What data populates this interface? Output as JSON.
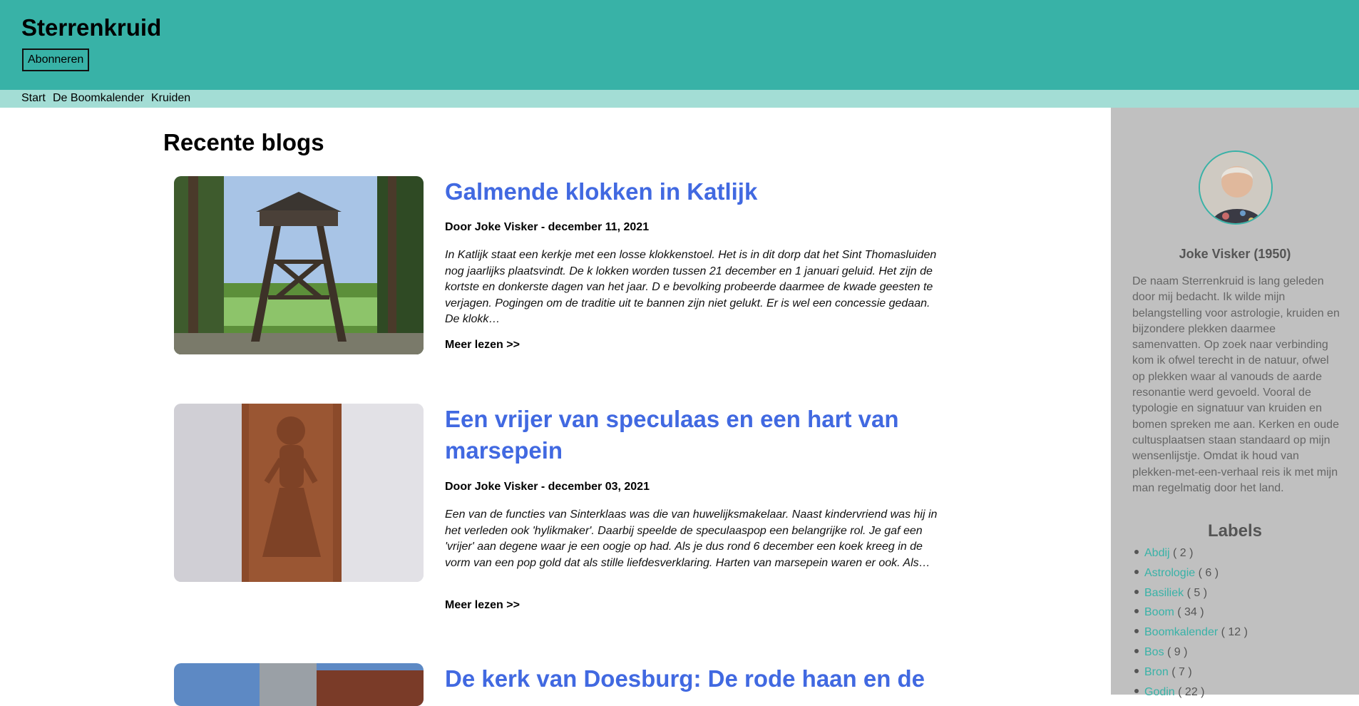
{
  "header": {
    "site_title": "Sterrenkruid",
    "subscribe_label": "Abonneren"
  },
  "nav": {
    "items": [
      {
        "label": "Start"
      },
      {
        "label": "De Boomkalender"
      },
      {
        "label": "Kruiden"
      }
    ]
  },
  "main": {
    "section_title": "Recente blogs",
    "posts": [
      {
        "title": "Galmende klokken in Katlijk",
        "meta": "Door Joke Visker - december 11, 2021",
        "excerpt": "In Katlijk staat een kerkje met een losse klokkenstoel.  Het is in dit dorp dat het Sint Thomasluiden nog jaarlijks plaatsvindt. De k lokken worden tussen 21 december en 1 januari geluid. Het zijn de kortste en donkerste dagen van het jaar. D e bevolking probeerde daarmee de kwade geesten te verjagen. Pogingen om de traditie uit te bannen zijn niet gelukt. Er is wel een concessie gedaan. De klokk…",
        "read_more": "Meer lezen >>"
      },
      {
        "title": "Een vrijer van speculaas en een hart van marsepein",
        "meta": "Door Joke Visker - december 03, 2021",
        "excerpt": "Een van de functies van Sinterklaas was die van huwelijksmakelaar. Naast kindervriend was hij in het verleden ook  'hylikmaker'. Daarbij speelde de speculaaspop een belangrijke rol.  Je gaf een 'vrijer' aan degene waar je een oogje op had.  Als je dus rond 6 december een koek kreeg in de vorm van een pop gold dat als stille liefdesverklaring. Harten van marsepein waren er ook. Als…",
        "read_more": "Meer lezen >>"
      },
      {
        "title": "De kerk van Doesburg: De rode haan en de"
      }
    ]
  },
  "sidebar": {
    "author_name": "Joke Visker (1950)",
    "author_bio": "De naam Sterrenkruid is lang geleden door mij bedacht. Ik wilde mijn belangstelling voor astrologie, kruiden en bijzondere plekken daarmee samenvatten. Op zoek naar verbinding kom ik ofwel terecht in de natuur, ofwel op plekken waar al vanouds de aarde resonantie werd gevoeld. Vooral de typologie en signatuur van kruiden en bomen spreken me aan. Kerken en oude cultusplaatsen staan standaard op mijn wensenlijstje. Omdat ik houd van plekken-met-een-verhaal reis ik met mijn man regelmatig door het land.",
    "labels_title": "Labels",
    "labels": [
      {
        "name": "Abdij",
        "count": "( 2 )"
      },
      {
        "name": "Astrologie",
        "count": "( 6 )"
      },
      {
        "name": "Basiliek",
        "count": "( 5 )"
      },
      {
        "name": "Boom",
        "count": "( 34 )"
      },
      {
        "name": "Boomkalender",
        "count": "( 12 )"
      },
      {
        "name": "Bos",
        "count": "( 9 )"
      },
      {
        "name": "Bron",
        "count": "( 7 )"
      },
      {
        "name": "Godin",
        "count": "( 22 )"
      }
    ]
  },
  "colors": {
    "header_bg": "#38b2a7",
    "nav_bg": "#a3ddd5",
    "sidebar_bg": "#c0c0c0",
    "post_title": "#4169e1",
    "label_link": "#38b2a7"
  }
}
